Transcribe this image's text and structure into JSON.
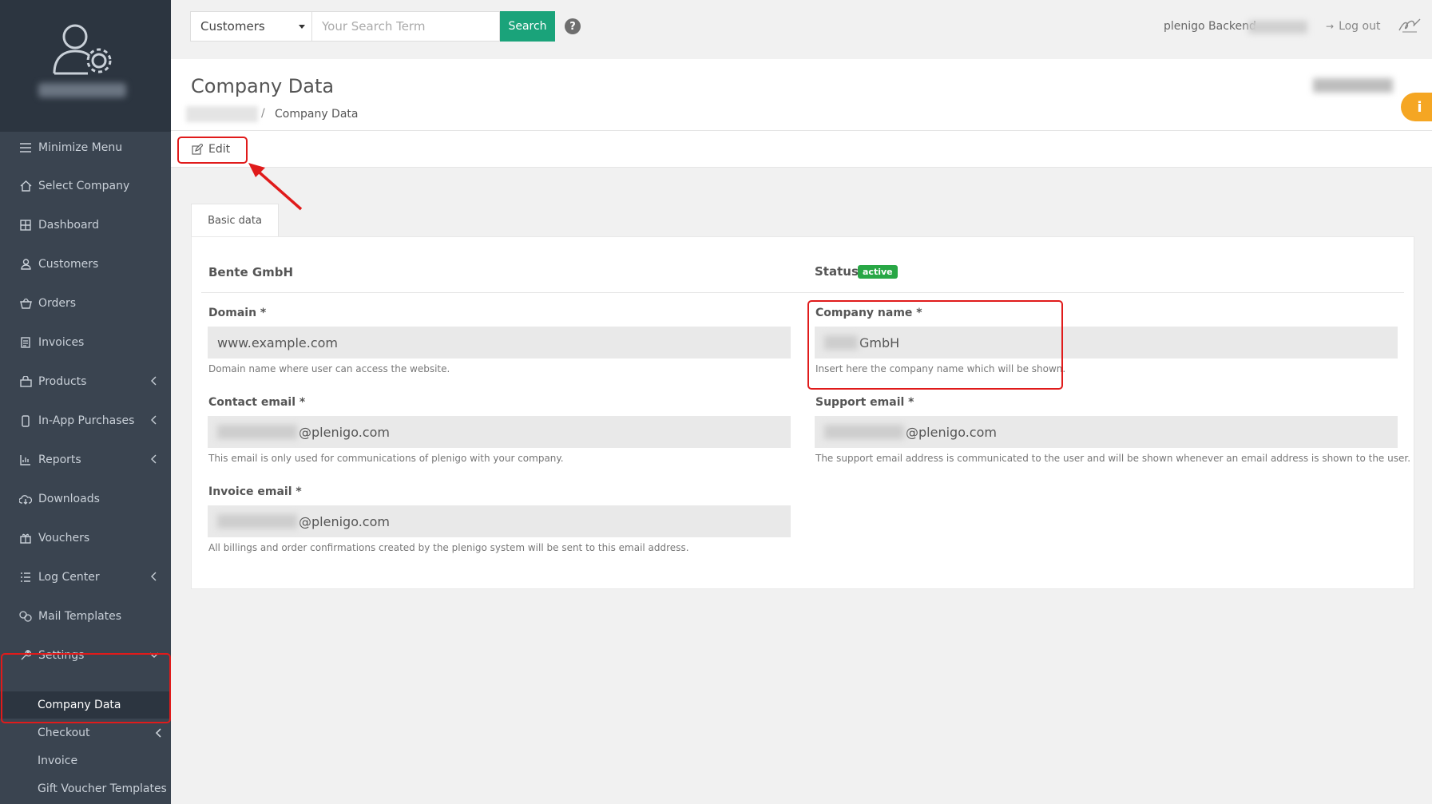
{
  "sidebar": {
    "menu": [
      {
        "label": "Minimize Menu",
        "icon": "menu-icon"
      },
      {
        "label": "Select Company",
        "icon": "home-icon"
      },
      {
        "label": "Dashboard",
        "icon": "grid-icon"
      },
      {
        "label": "Customers",
        "icon": "user-icon"
      },
      {
        "label": "Orders",
        "icon": "basket-icon"
      },
      {
        "label": "Invoices",
        "icon": "document-icon"
      },
      {
        "label": "Products",
        "icon": "shopping-bag-icon"
      },
      {
        "label": "In-App Purchases",
        "icon": "mobile-icon"
      },
      {
        "label": "Reports",
        "icon": "bar-chart-icon"
      },
      {
        "label": "Downloads",
        "icon": "cloud-download-icon"
      },
      {
        "label": "Vouchers",
        "icon": "gift-icon"
      },
      {
        "label": "Log Center",
        "icon": "list-icon"
      },
      {
        "label": "Mail Templates",
        "icon": "mail-template-icon"
      },
      {
        "label": "Settings",
        "icon": "wrench-icon"
      }
    ],
    "submenu": [
      {
        "label": "Company Data"
      },
      {
        "label": "Checkout"
      },
      {
        "label": "Invoice"
      },
      {
        "label": "Gift Voucher Templates"
      }
    ]
  },
  "topbar": {
    "search_scope": "Customers",
    "search_placeholder": "Your Search Term",
    "search_button": "Search",
    "help": "?",
    "backend_label": "plenigo Backend",
    "logout": "Log out"
  },
  "header": {
    "title": "Company Data",
    "breadcrumb_separator": "/",
    "breadcrumb_current": "Company Data",
    "info": "i"
  },
  "toolbar": {
    "edit_label": "Edit"
  },
  "tabs": {
    "basic": "Basic data"
  },
  "company": {
    "name_heading": "Bente GmbH",
    "status_label": "Status",
    "status_value": "active",
    "domain_label": "Domain *",
    "domain_value": "www.example.com",
    "domain_help": "Domain name where user can access the website.",
    "company_name_label": "Company name *",
    "company_name_value": "GmbH",
    "company_name_help": "Insert here the company name which will be shown.",
    "contact_email_label": "Contact email *",
    "contact_email_value": "@plenigo.com",
    "contact_email_help": "This email is only used for communications of plenigo with your company.",
    "support_email_label": "Support email *",
    "support_email_value": "@plenigo.com",
    "support_email_help": "The support email address is communicated to the user and will be shown whenever an email address is shown to the user.",
    "invoice_email_label": "Invoice email *",
    "invoice_email_value": "@plenigo.com",
    "invoice_email_help": "All billings and order confirmations created by the plenigo system will be sent to this email address."
  },
  "colors": {
    "sidebar": "#3a4450",
    "accent_green": "#1aa37a",
    "highlight_red": "#e01b1b",
    "info_orange": "#f5a623"
  }
}
